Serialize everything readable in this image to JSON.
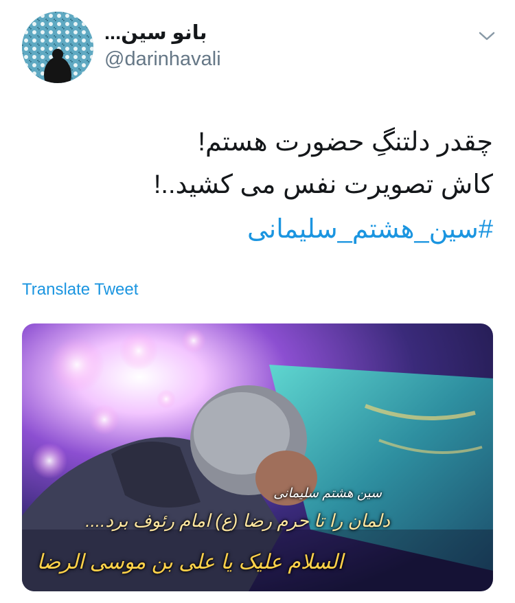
{
  "tweet": {
    "author": {
      "display_name": "بانو سین...",
      "handle": "@darinhavali"
    },
    "text_lines": [
      "چقدر دلتنگِ حضورت هستم!",
      "کاش تصویرت نفس می کشید..!"
    ],
    "hashtag": "#سین_هشتم_سلیمانی",
    "translate_label": "Translate Tweet",
    "menu_icon": "chevron-down-icon",
    "media": {
      "caption_lines": [
        "سین هشتم سلیمانی",
        "دلمان را تا حرم رضا (ع) امام رئوف برد....",
        "السلام علیک یا علی بن موسی الرضا"
      ]
    }
  },
  "colors": {
    "accent": "#1b95e0",
    "secondary_text": "#657786",
    "text": "#14171a"
  }
}
